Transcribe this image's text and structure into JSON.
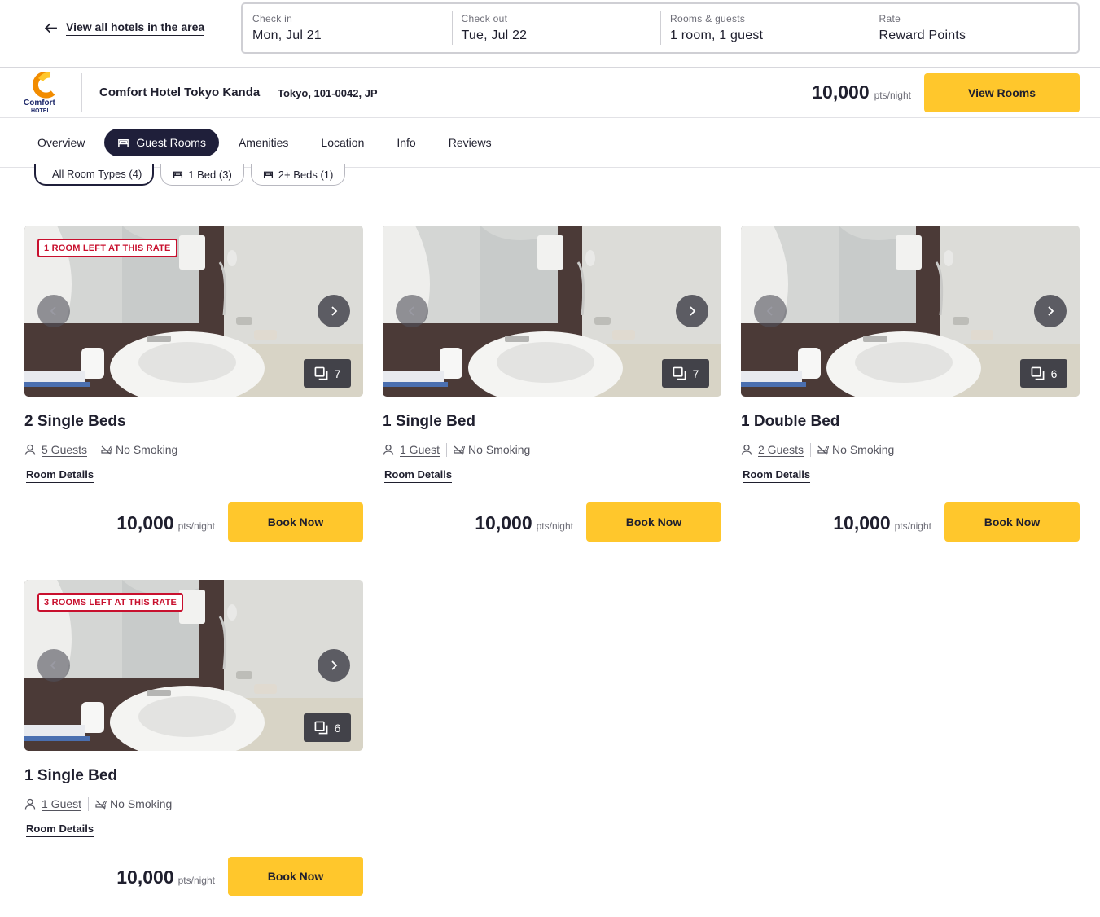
{
  "colors": {
    "accent_yellow": "#ffc72c",
    "dark_navy": "#1f1f3a",
    "badge_red": "#c8102e"
  },
  "search": {
    "back_label": "View all hotels in the area",
    "check_in": {
      "label": "Check in",
      "value": "Mon, Jul 21"
    },
    "check_out": {
      "label": "Check out",
      "value": "Tue, Jul 22"
    },
    "rooms_guests": {
      "label": "Rooms & guests",
      "value": "1 room, 1 guest"
    },
    "rate": {
      "label": "Rate",
      "value": "Reward Points"
    }
  },
  "hotel": {
    "logo_text": "Comfort",
    "logo_sub": "HOTEL",
    "name": "Comfort Hotel Tokyo Kanda",
    "address": "Tokyo, 101-0042, JP",
    "price": "10,000",
    "price_unit": "pts/night",
    "view_rooms_label": "View Rooms"
  },
  "tabs": [
    {
      "label": "Overview"
    },
    {
      "label": "Guest Rooms"
    },
    {
      "label": "Amenities"
    },
    {
      "label": "Location"
    },
    {
      "label": "Info"
    },
    {
      "label": "Reviews"
    }
  ],
  "filters": [
    {
      "label": "All Room Types (4)"
    },
    {
      "label": "1 Bed (3)"
    },
    {
      "label": "2+ Beds (1)"
    }
  ],
  "rooms": [
    {
      "badge": "1 ROOM LEFT AT THIS RATE",
      "photo_count": "7",
      "title": "2 Single Beds",
      "guests": "5 Guests",
      "smoking": "No Smoking",
      "details_label": "Room Details",
      "price": "10,000",
      "price_unit": "pts/night",
      "book_label": "Book Now"
    },
    {
      "badge": "",
      "photo_count": "7",
      "title": "1 Single Bed",
      "guests": "1 Guest",
      "smoking": "No Smoking",
      "details_label": "Room Details",
      "price": "10,000",
      "price_unit": "pts/night",
      "book_label": "Book Now"
    },
    {
      "badge": "",
      "photo_count": "6",
      "title": "1 Double Bed",
      "guests": "2 Guests",
      "smoking": "No Smoking",
      "details_label": "Room Details",
      "price": "10,000",
      "price_unit": "pts/night",
      "book_label": "Book Now"
    },
    {
      "badge": "3 ROOMS LEFT AT THIS RATE",
      "photo_count": "6",
      "title": "1 Single Bed",
      "guests": "1 Guest",
      "smoking": "No Smoking",
      "details_label": "Room Details",
      "price": "10,000",
      "price_unit": "pts/night",
      "book_label": "Book Now"
    }
  ]
}
